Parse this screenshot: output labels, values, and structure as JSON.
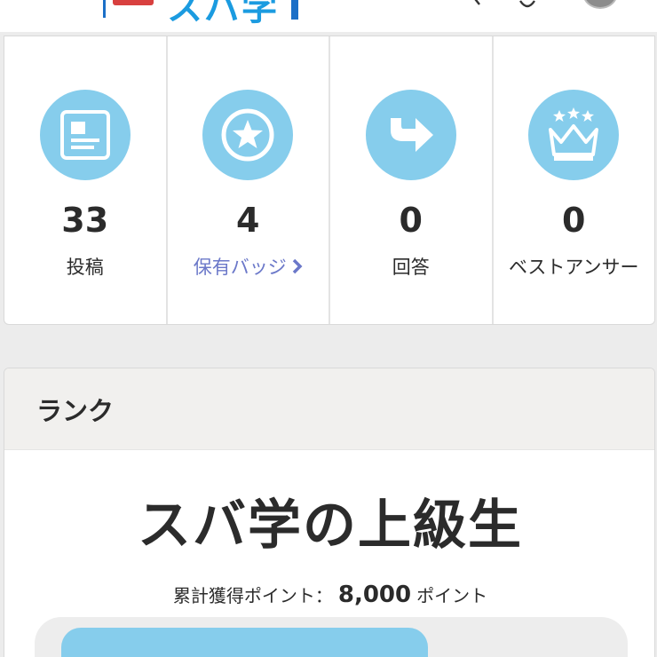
{
  "header": {
    "logo_text": "スバ学",
    "logo_badge": "スバ学"
  },
  "stats": [
    {
      "icon": "article-icon",
      "count": "33",
      "label": "投稿",
      "link": false
    },
    {
      "icon": "badge-star-icon",
      "count": "4",
      "label": "保有バッジ",
      "link": true
    },
    {
      "icon": "reply-arrow-icon",
      "count": "0",
      "label": "回答",
      "link": false
    },
    {
      "icon": "crown-icon",
      "count": "0",
      "label": "ベストアンサー",
      "link": false
    }
  ],
  "rank": {
    "heading": "ランク",
    "name": "スバ学の上級生",
    "points_label": "累計獲得ポイント：",
    "points_value": "8,000",
    "points_unit": "ポイント",
    "progress_fraction": 0.68
  },
  "colors": {
    "accent": "#86cdec",
    "link": "#6b78c9",
    "logo_blue": "#1b9be0"
  }
}
